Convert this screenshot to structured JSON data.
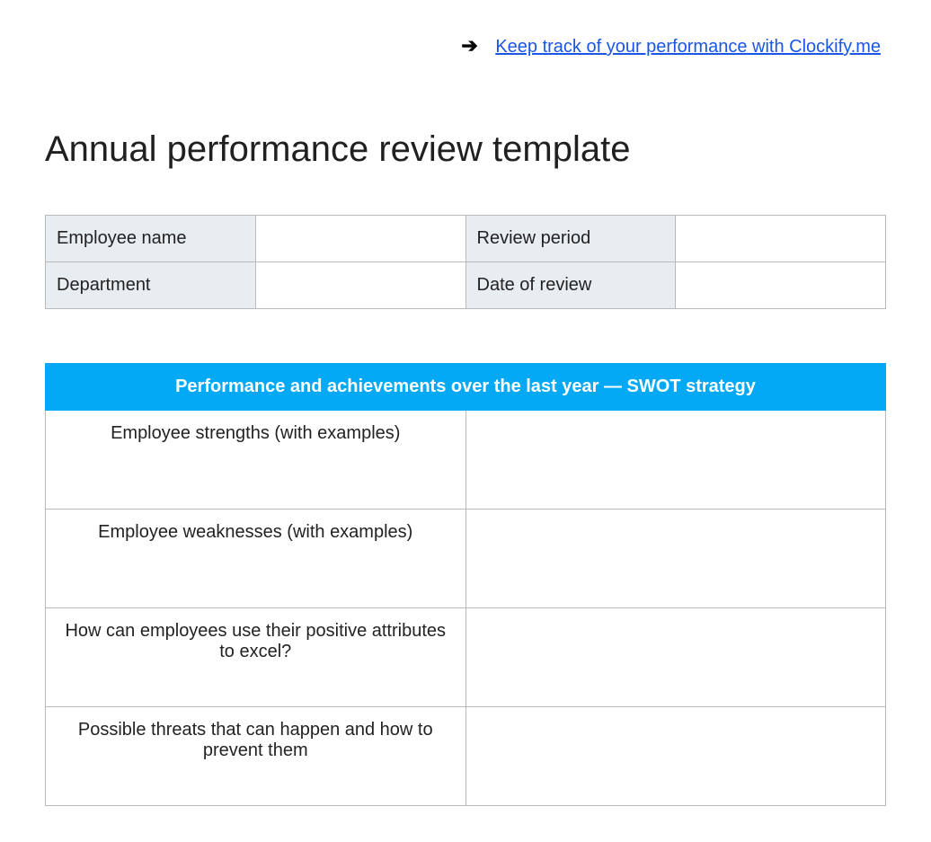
{
  "header_link": {
    "text": "Keep track of your performance with Clockify.me"
  },
  "title": "Annual performance review template",
  "info": {
    "employee_name_label": "Employee name",
    "employee_name_value": "",
    "review_period_label": "Review period",
    "review_period_value": "",
    "department_label": "Department",
    "department_value": "",
    "date_of_review_label": "Date of review",
    "date_of_review_value": ""
  },
  "swot": {
    "header": "Performance and achievements over the last year — SWOT strategy",
    "rows": [
      {
        "prompt": "Employee strengths (with examples)",
        "answer": ""
      },
      {
        "prompt": "Employee weaknesses (with examples)",
        "answer": ""
      },
      {
        "prompt": "How can employees use their positive attributes to excel?",
        "answer": ""
      },
      {
        "prompt": "Possible threats that can happen and how to prevent them",
        "answer": ""
      }
    ]
  }
}
